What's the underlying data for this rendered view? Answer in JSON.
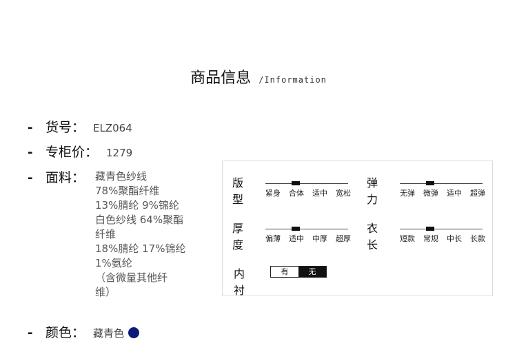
{
  "header": {
    "title": "商品信息",
    "subtitle": "/Information"
  },
  "fields": {
    "sku": {
      "label": "货号：",
      "value": "ELZ064"
    },
    "price": {
      "label": "专柜价：",
      "value": "1279"
    },
    "material": {
      "label": "面料：",
      "lines": [
        "藏青色纱线",
        "78%聚酯纤维",
        "13%腈纶 9%锦纶",
        "白色纱线 64%聚酯",
        "纤维",
        "18%腈纶 17%锦纶",
        "1%氨纶",
        "（含微量其他纤",
        "维）"
      ]
    },
    "color": {
      "label": "颜色：",
      "value": "藏青色",
      "swatch": "#0b1a7a"
    }
  },
  "specs": {
    "fit": {
      "name": "版型",
      "options": [
        "紧身",
        "合体",
        "适中",
        "宽松"
      ],
      "selected": 1
    },
    "elasticity": {
      "name": "弹力",
      "options": [
        "无弹",
        "微弹",
        "适中",
        "超弹"
      ],
      "selected": 1
    },
    "thickness": {
      "name": "厚度",
      "options": [
        "偏薄",
        "适中",
        "中厚",
        "超厚"
      ],
      "selected": 1
    },
    "length": {
      "name": "衣长",
      "options": [
        "短款",
        "常规",
        "中长",
        "长款"
      ],
      "selected": 1
    },
    "lining": {
      "name": "内衬",
      "options": [
        "有",
        "无"
      ],
      "selected": 1
    }
  }
}
